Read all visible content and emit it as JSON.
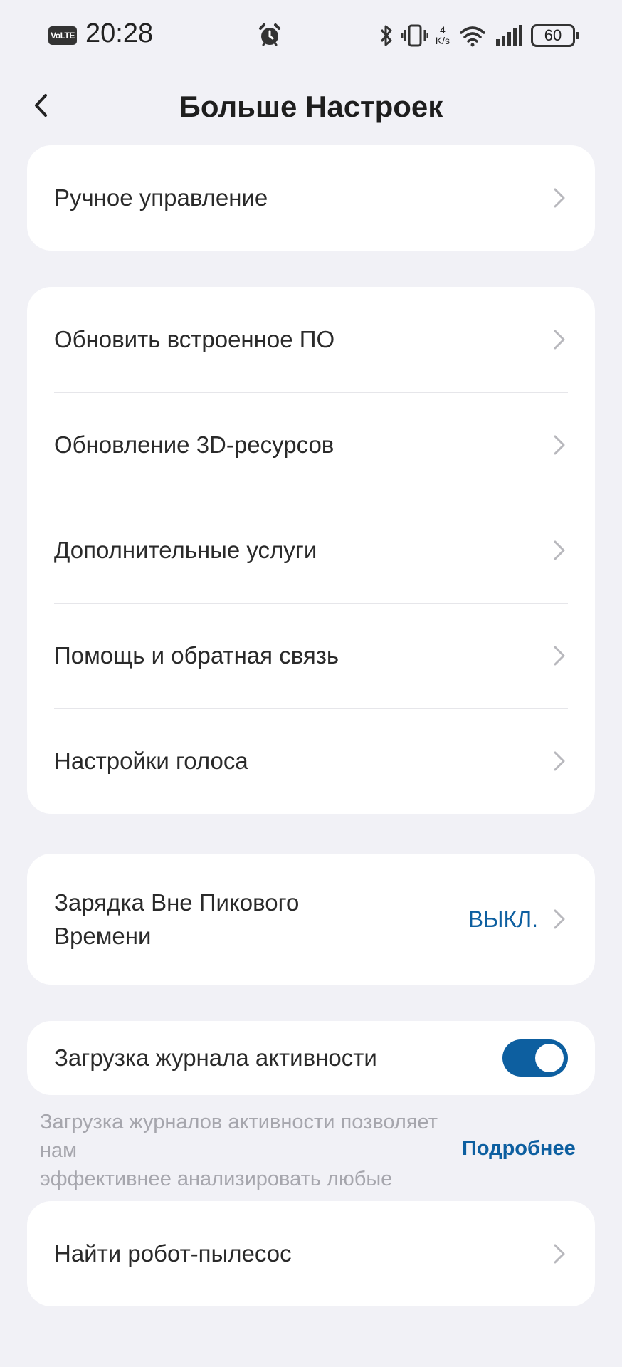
{
  "status_bar": {
    "volte": "VoLTE",
    "time": "20:28",
    "net_speed_value": "4",
    "net_speed_unit": "K/s",
    "battery": "60",
    "icons": [
      "alarm-icon",
      "bluetooth-icon",
      "vibrate-icon",
      "wifi-icon",
      "signal-icon",
      "battery-icon"
    ]
  },
  "header": {
    "title": "Больше Настроек"
  },
  "card_manual": {
    "items": [
      {
        "label": "Ручное управление"
      }
    ]
  },
  "card_main": {
    "items": [
      {
        "label": "Обновить встроенное ПО"
      },
      {
        "label": "Обновление 3D-ресурсов"
      },
      {
        "label": "Дополнительные услуги"
      },
      {
        "label": "Помощь и обратная связь"
      },
      {
        "label": "Настройки голоса"
      }
    ]
  },
  "offpeak": {
    "label_line1": "Зарядка Вне Пикового",
    "label_line2": "Времени",
    "value": "ВЫКЛ."
  },
  "activity_log": {
    "label": "Загрузка журнала активности",
    "toggle_on": true,
    "note_line1": "Загрузка журналов активности позволяет нам",
    "note_line2": "эффективнее анализировать любые",
    "more_link": "Подробнее"
  },
  "find_robot": {
    "label": "Найти робот-пылесос"
  },
  "colors": {
    "background": "#f1f1f6",
    "card": "#ffffff",
    "accent": "#0d5fa0",
    "chevron": "#b8b8bd"
  }
}
